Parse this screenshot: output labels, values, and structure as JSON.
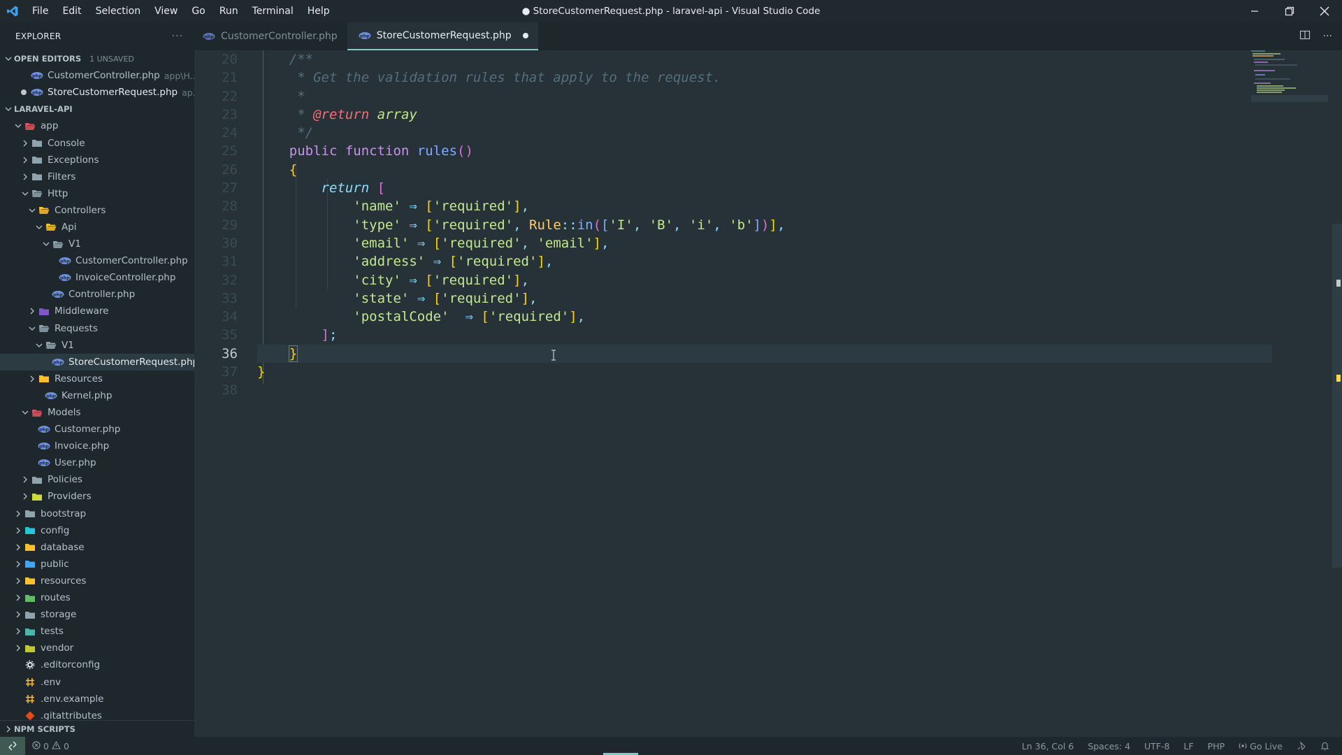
{
  "window": {
    "title": "● StoreCustomerRequest.php - laravel-api - Visual Studio Code",
    "menu": [
      "File",
      "Edit",
      "Selection",
      "View",
      "Go",
      "Run",
      "Terminal",
      "Help"
    ]
  },
  "explorer": {
    "title": "EXPLORER",
    "open_editors": {
      "label": "OPEN EDITORS",
      "count": "1 UNSAVED",
      "items": [
        {
          "name": "CustomerController.php",
          "path": "app\\H..."
        },
        {
          "name": "StoreCustomerRequest.php",
          "path": "ap..."
        }
      ]
    },
    "project": {
      "label": "LARAVEL-API",
      "tree": [
        {
          "label": "app",
          "depth": 0,
          "kind": "folder",
          "open": true,
          "color": "#e05561"
        },
        {
          "label": "Console",
          "depth": 1,
          "kind": "folder",
          "open": false,
          "color": "#90a4ae"
        },
        {
          "label": "Exceptions",
          "depth": 1,
          "kind": "folder",
          "open": false,
          "color": "#90a4ae"
        },
        {
          "label": "Filters",
          "depth": 1,
          "kind": "folder",
          "open": false,
          "color": "#90a4ae"
        },
        {
          "label": "Http",
          "depth": 1,
          "kind": "folder",
          "open": true,
          "color": "#90a4ae"
        },
        {
          "label": "Controllers",
          "depth": 2,
          "kind": "folder",
          "open": true,
          "color": "#fbc02d"
        },
        {
          "label": "Api",
          "depth": 3,
          "kind": "folder",
          "open": true,
          "color": "#fbc02d"
        },
        {
          "label": "V1",
          "depth": 4,
          "kind": "folder",
          "open": true,
          "color": "#90a4ae"
        },
        {
          "label": "CustomerController.php",
          "depth": 5,
          "kind": "php"
        },
        {
          "label": "InvoiceController.php",
          "depth": 5,
          "kind": "php"
        },
        {
          "label": "Controller.php",
          "depth": 4,
          "kind": "php"
        },
        {
          "label": "Middleware",
          "depth": 2,
          "kind": "folder",
          "open": false,
          "color": "#7e57c2"
        },
        {
          "label": "Requests",
          "depth": 2,
          "kind": "folder",
          "open": true,
          "color": "#90a4ae"
        },
        {
          "label": "V1",
          "depth": 3,
          "kind": "folder",
          "open": true,
          "color": "#90a4ae"
        },
        {
          "label": "StoreCustomerRequest.php",
          "depth": 4,
          "kind": "php",
          "selected": true
        },
        {
          "label": "Resources",
          "depth": 2,
          "kind": "folder",
          "open": false,
          "color": "#fbc02d"
        },
        {
          "label": "Kernel.php",
          "depth": 3,
          "kind": "php"
        },
        {
          "label": "Models",
          "depth": 1,
          "kind": "folder",
          "open": true,
          "color": "#e05561"
        },
        {
          "label": "Customer.php",
          "depth": 2,
          "kind": "php"
        },
        {
          "label": "Invoice.php",
          "depth": 2,
          "kind": "php"
        },
        {
          "label": "User.php",
          "depth": 2,
          "kind": "php"
        },
        {
          "label": "Policies",
          "depth": 1,
          "kind": "folder",
          "open": false,
          "color": "#90a4ae"
        },
        {
          "label": "Providers",
          "depth": 1,
          "kind": "folder",
          "open": false,
          "color": "#cddc39"
        },
        {
          "label": "bootstrap",
          "depth": 0,
          "kind": "folder",
          "open": false,
          "color": "#90a4ae"
        },
        {
          "label": "config",
          "depth": 0,
          "kind": "folder",
          "open": false,
          "color": "#26c6da"
        },
        {
          "label": "database",
          "depth": 0,
          "kind": "folder",
          "open": false,
          "color": "#fbc02d"
        },
        {
          "label": "public",
          "depth": 0,
          "kind": "folder",
          "open": false,
          "color": "#42a5f5"
        },
        {
          "label": "resources",
          "depth": 0,
          "kind": "folder",
          "open": false,
          "color": "#fbc02d"
        },
        {
          "label": "routes",
          "depth": 0,
          "kind": "folder",
          "open": false,
          "color": "#66bb6a"
        },
        {
          "label": "storage",
          "depth": 0,
          "kind": "folder",
          "open": false,
          "color": "#90a4ae"
        },
        {
          "label": "tests",
          "depth": 0,
          "kind": "folder",
          "open": false,
          "color": "#4db6ac"
        },
        {
          "label": "vendor",
          "depth": 0,
          "kind": "folder",
          "open": false,
          "color": "#c0ca33"
        },
        {
          "label": ".editorconfig",
          "depth": 0,
          "kind": "editorconfig"
        },
        {
          "label": ".env",
          "depth": 0,
          "kind": "env"
        },
        {
          "label": ".env.example",
          "depth": 0,
          "kind": "env"
        },
        {
          "label": ".gitattributes",
          "depth": 0,
          "kind": "git"
        }
      ]
    },
    "npm_scripts": "NPM SCRIPTS"
  },
  "tabs": [
    {
      "label": "CustomerController.php",
      "active": false
    },
    {
      "label": "StoreCustomerRequest.php",
      "active": true,
      "modified": true
    }
  ],
  "editor": {
    "line_numbers": [
      "20",
      "21",
      "22",
      "23",
      "24",
      "25",
      "26",
      "27",
      "28",
      "29",
      "30",
      "31",
      "32",
      "33",
      "34",
      "35",
      "36",
      "37",
      "38"
    ],
    "current_line": "36"
  },
  "statusbar": {
    "errors": "0",
    "warnings": "0",
    "position": "Ln 36, Col 6",
    "spaces": "Spaces: 4",
    "encoding": "UTF-8",
    "eol": "LF",
    "language": "PHP",
    "golive": "Go Live"
  },
  "colors": {
    "accent": "#80cbc4",
    "php_icon": "#6f8fdf",
    "editor_bg": "#263238",
    "sidebar_bg": "#1e272c"
  }
}
